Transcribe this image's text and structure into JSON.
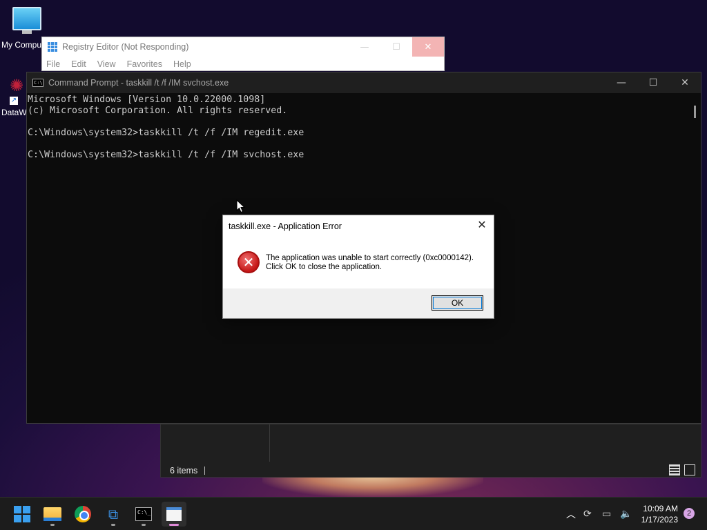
{
  "desktop": {
    "icons": [
      {
        "label": "My Compu",
        "icon": "computer-icon"
      },
      {
        "label": "DataW",
        "icon": "datawedge-icon"
      }
    ]
  },
  "regedit": {
    "title": "Registry Editor (Not Responding)",
    "menu": [
      "File",
      "Edit",
      "View",
      "Favorites",
      "Help"
    ]
  },
  "cmd": {
    "title": "Command Prompt - taskkill  /t /f /IM svchost.exe",
    "lines": [
      "Microsoft Windows [Version 10.0.22000.1098]",
      "(c) Microsoft Corporation. All rights reserved.",
      "",
      "C:\\Windows\\system32>taskkill /t /f /IM regedit.exe",
      "",
      "C:\\Windows\\system32>taskkill /t /f /IM svchost.exe"
    ]
  },
  "dialog": {
    "title": "taskkill.exe - Application Error",
    "message_line1": "The application was unable to start correctly (0xc0000142).",
    "message_line2": "Click OK to close the application.",
    "ok_label": "OK",
    "icon": "error-icon"
  },
  "explorer": {
    "status": "6 items"
  },
  "taskbar": {
    "apps": [
      "start-icon",
      "file-explorer-icon",
      "chrome-icon",
      "registry-editor-icon",
      "command-prompt-icon",
      "notepad-icon"
    ],
    "time": "10:09 AM",
    "date": "1/17/2023",
    "notification_count": "2"
  },
  "colors": {
    "error_red": "#c51616",
    "accent": "#0078d7",
    "taskbar_bg": "#1c1c1c"
  }
}
